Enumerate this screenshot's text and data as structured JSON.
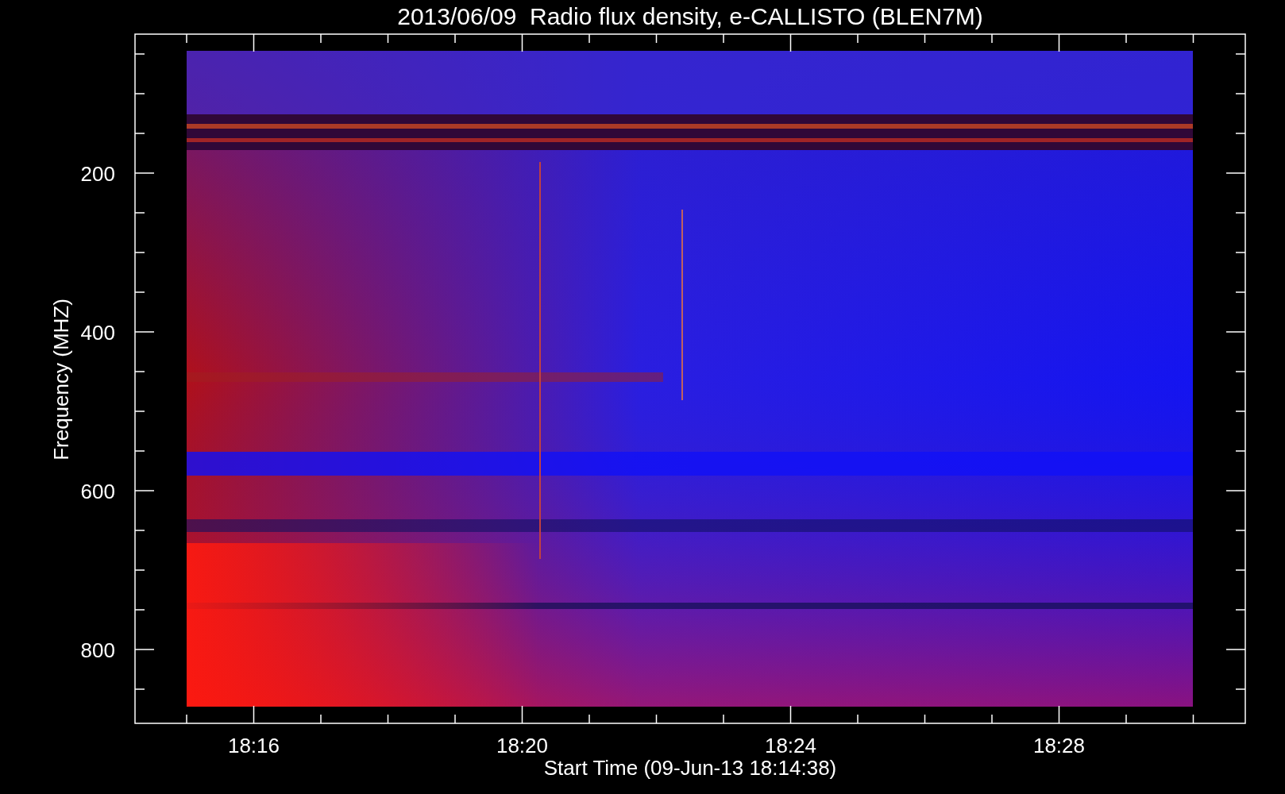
{
  "title": "2013/06/09  Radio flux density, e-CALLISTO (BLEN7M)",
  "y_axis": {
    "label": "Frequency (MHZ)",
    "ticks": [
      "200",
      "400",
      "600",
      "800"
    ]
  },
  "x_axis": {
    "label": "Start Time (09-Jun-13 18:14:38)",
    "ticks": [
      "18:16",
      "18:20",
      "18:24",
      "18:28"
    ]
  }
}
